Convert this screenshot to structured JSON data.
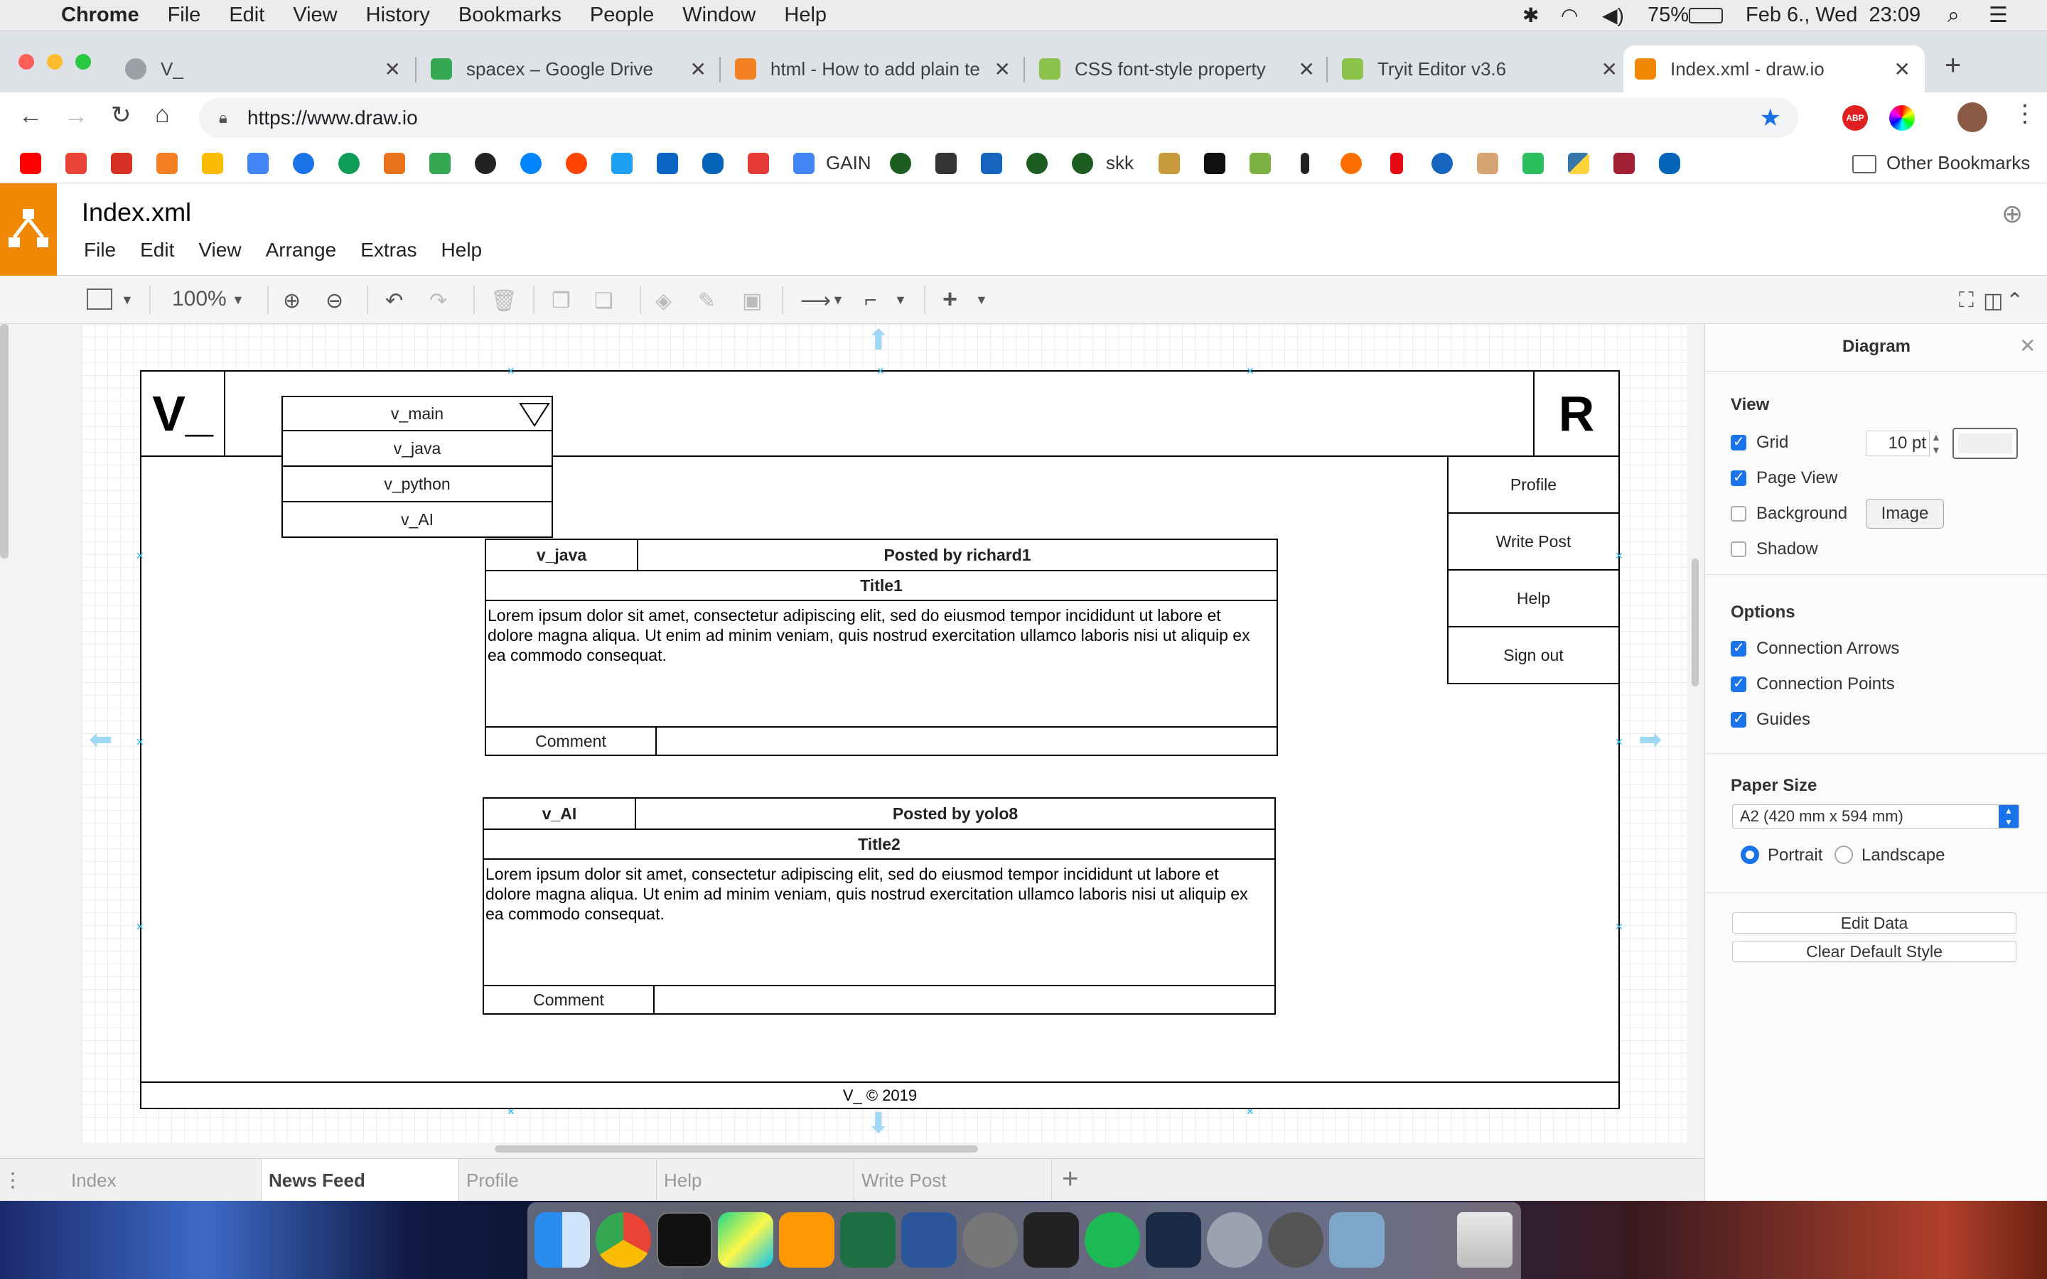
{
  "mac_menu": {
    "apple_icon": "apple-icon",
    "app": "Chrome",
    "items": [
      "File",
      "Edit",
      "View",
      "History",
      "Bookmarks",
      "People",
      "Window",
      "Help"
    ],
    "battery": "75%",
    "datetime": "Feb 6., Wed  23:09"
  },
  "tabs": [
    {
      "title": "V_",
      "color": "#9aa0a6"
    },
    {
      "title": "spacex – Google Drive",
      "color": "#34a853"
    },
    {
      "title": "html - How to add plain te",
      "color": "#f48024"
    },
    {
      "title": "CSS font-style property",
      "color": "#8bc34a"
    },
    {
      "title": "Tryit Editor v3.6",
      "color": "#8bc34a"
    },
    {
      "title": "Index.xml - draw.io",
      "color": "#f08705"
    }
  ],
  "url": "https://www.draw.io",
  "bookmarks": {
    "labels": [
      "GAIN",
      "skk"
    ],
    "other": "Other Bookmarks"
  },
  "drawio": {
    "title": "Index.xml",
    "menu": [
      "File",
      "Edit",
      "View",
      "Arrange",
      "Extras",
      "Help"
    ],
    "zoom": "100%"
  },
  "diagram": {
    "logo": "V_",
    "avatar_letter": "R",
    "dropdown": [
      "v_main",
      "v_java",
      "v_python",
      "v_AI"
    ],
    "side_menu": [
      "Profile",
      "Write Post",
      "Help",
      "Sign out"
    ],
    "posts": [
      {
        "category": "v_java",
        "author": "Posted by richard1",
        "title": "Title1",
        "body": "Lorem ipsum dolor sit amet, consectetur adipiscing elit, sed do eiusmod tempor incididunt ut labore et dolore magna aliqua. Ut enim ad minim veniam, quis nostrud exercitation ullamco laboris nisi ut aliquip ex ea commodo consequat.",
        "comment": "Comment"
      },
      {
        "category": "v_AI",
        "author": "Posted by yolo8",
        "title": "Title2",
        "body": "Lorem ipsum dolor sit amet, consectetur adipiscing elit, sed do eiusmod tempor incididunt ut labore et dolore magna aliqua. Ut enim ad minim veniam, quis nostrud exercitation ullamco laboris nisi ut aliquip ex ea commodo consequat.",
        "comment": "Comment"
      }
    ],
    "footer": "V_ © 2019"
  },
  "page_tabs": [
    "Index",
    "News Feed",
    "Profile",
    "Help",
    "Write Post"
  ],
  "active_page": "News Feed",
  "panel": {
    "title": "Diagram",
    "view_h": "View",
    "grid": "Grid",
    "grid_size": "10 pt",
    "page_view": "Page View",
    "background": "Background",
    "image_btn": "Image",
    "shadow": "Shadow",
    "options_h": "Options",
    "conn_arrows": "Connection Arrows",
    "conn_points": "Connection Points",
    "guides": "Guides",
    "paper_h": "Paper Size",
    "paper": "A2 (420 mm x 594 mm)",
    "portrait": "Portrait",
    "landscape": "Landscape",
    "edit_data": "Edit Data",
    "clear_style": "Clear Default Style"
  }
}
